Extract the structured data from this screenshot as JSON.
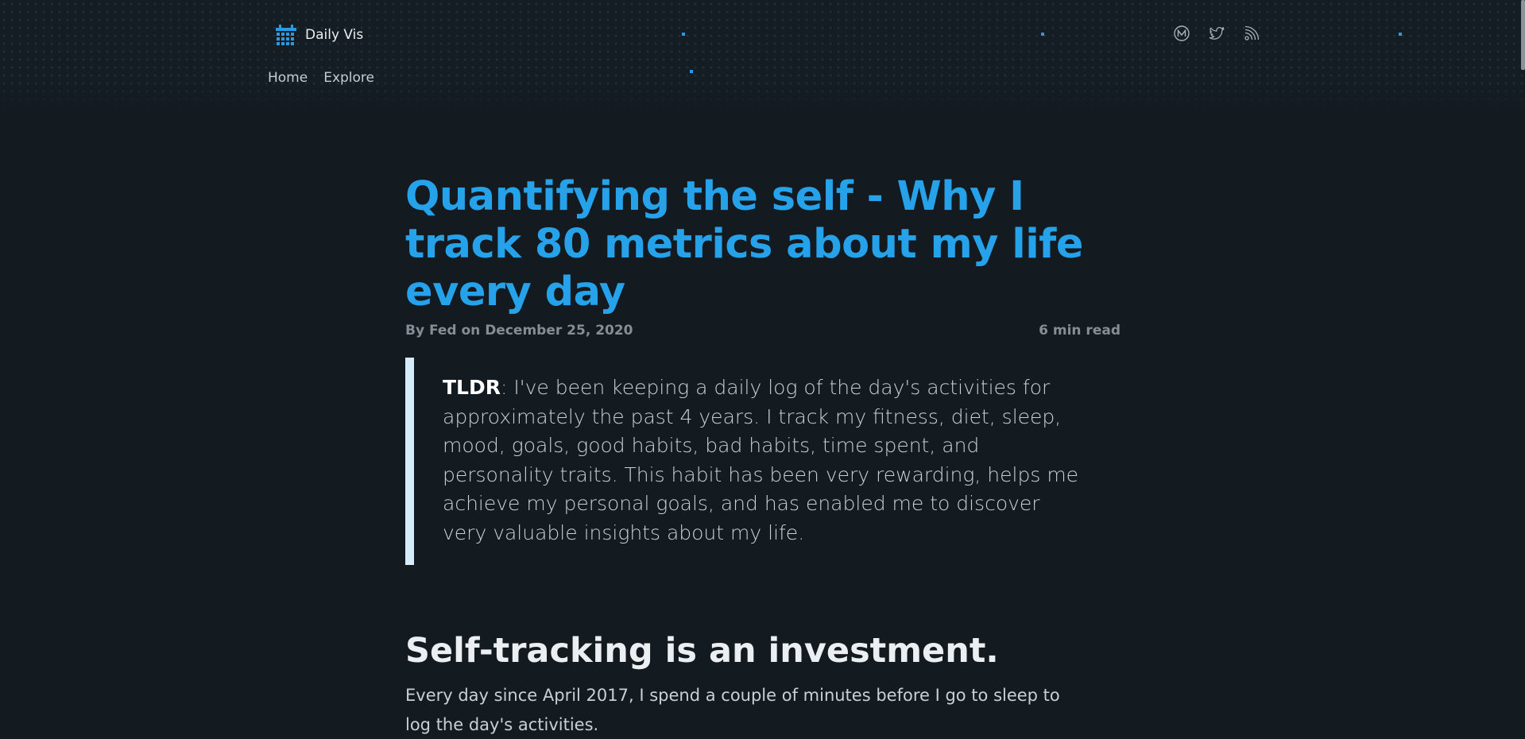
{
  "site": {
    "name": "Daily Vis",
    "logo_icon": "calendar-grid-icon",
    "accent_color": "#26a2ea"
  },
  "nav": {
    "items": [
      {
        "label": "Home"
      },
      {
        "label": "Explore"
      }
    ]
  },
  "social": [
    {
      "icon": "medium-icon"
    },
    {
      "icon": "twitter-icon"
    },
    {
      "icon": "rss-icon"
    }
  ],
  "article": {
    "title": "Quantifying the self - Why I track 80 metrics about my life every day",
    "byline": "By Fed on December 25, 2020",
    "read_time": "6 min read",
    "tldr_label": "TLDR",
    "tldr_text": ": I've been keeping a daily log of the day's activities for approximately the past 4 years. I track my fitness, diet, sleep, mood, goals, good habits, bad habits, time spent, and personality traits. This habit has been very rewarding, helps me achieve my personal goals, and has enabled me to discover very valuable insights about my life.",
    "section_heading": "Self-tracking is an investment.",
    "paragraph": "Every day since April 2017, I spend a couple of minutes before I go to sleep to log the day's activities."
  }
}
